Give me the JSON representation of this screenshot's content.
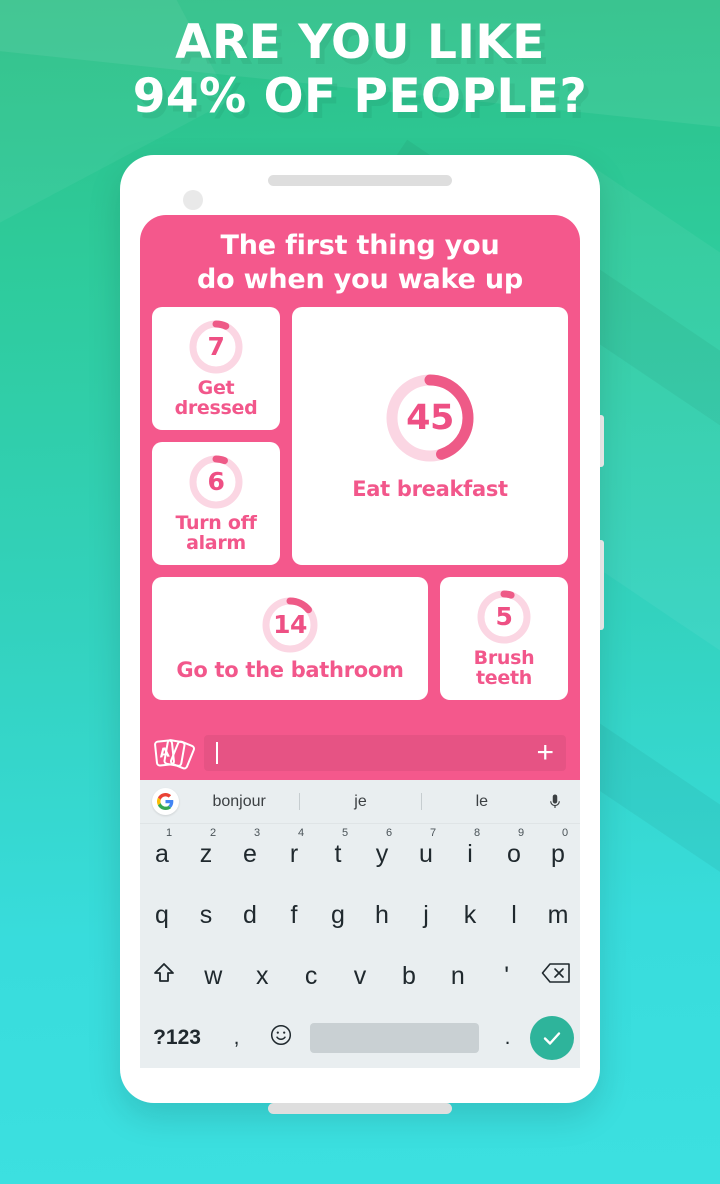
{
  "headline": {
    "line1": "ARE YOU LIKE",
    "line2": "94% OF PEOPLE?"
  },
  "colors": {
    "pink": "#F4588C",
    "pink_text": "#F2578B",
    "ring_track": "#FBD6E3",
    "ring_arc": "#EE5A87",
    "bg_green_top": "#2CBF86",
    "bg_teal_bottom": "#3CE0E0",
    "enter_teal": "#2EB49B"
  },
  "app": {
    "question_line1": "The first thing you",
    "question_line2": "do when you wake up",
    "answers": [
      {
        "label": "Get dressed",
        "value": "7",
        "percent": 7,
        "size": "small"
      },
      {
        "label": "Turn off alarm",
        "value": "6",
        "percent": 6,
        "size": "small"
      },
      {
        "label": "Eat breakfast",
        "value": "45",
        "percent": 45,
        "size": "big"
      },
      {
        "label": "Go to the bathroom",
        "value": "14",
        "percent": 14,
        "size": "wide"
      },
      {
        "label": "Brush teeth",
        "value": "5",
        "percent": 5,
        "size": "small"
      }
    ],
    "input": {
      "value": "",
      "placeholder": "",
      "add_label": "+",
      "cards_icon_letter": "A"
    }
  },
  "keyboard": {
    "suggestions": [
      "bonjour",
      "je",
      "le"
    ],
    "row1": [
      {
        "key": "a",
        "num": "1"
      },
      {
        "key": "z",
        "num": "2"
      },
      {
        "key": "e",
        "num": "3"
      },
      {
        "key": "r",
        "num": "4"
      },
      {
        "key": "t",
        "num": "5"
      },
      {
        "key": "y",
        "num": "6"
      },
      {
        "key": "u",
        "num": "7"
      },
      {
        "key": "i",
        "num": "8"
      },
      {
        "key": "o",
        "num": "9"
      },
      {
        "key": "p",
        "num": "0"
      }
    ],
    "row2": [
      "q",
      "s",
      "d",
      "f",
      "g",
      "h",
      "j",
      "k",
      "l",
      "m"
    ],
    "row3": [
      "w",
      "x",
      "c",
      "v",
      "b",
      "n",
      "'"
    ],
    "bottom": {
      "symbols": "?123",
      "comma": ",",
      "period": ".",
      "space": ""
    }
  }
}
